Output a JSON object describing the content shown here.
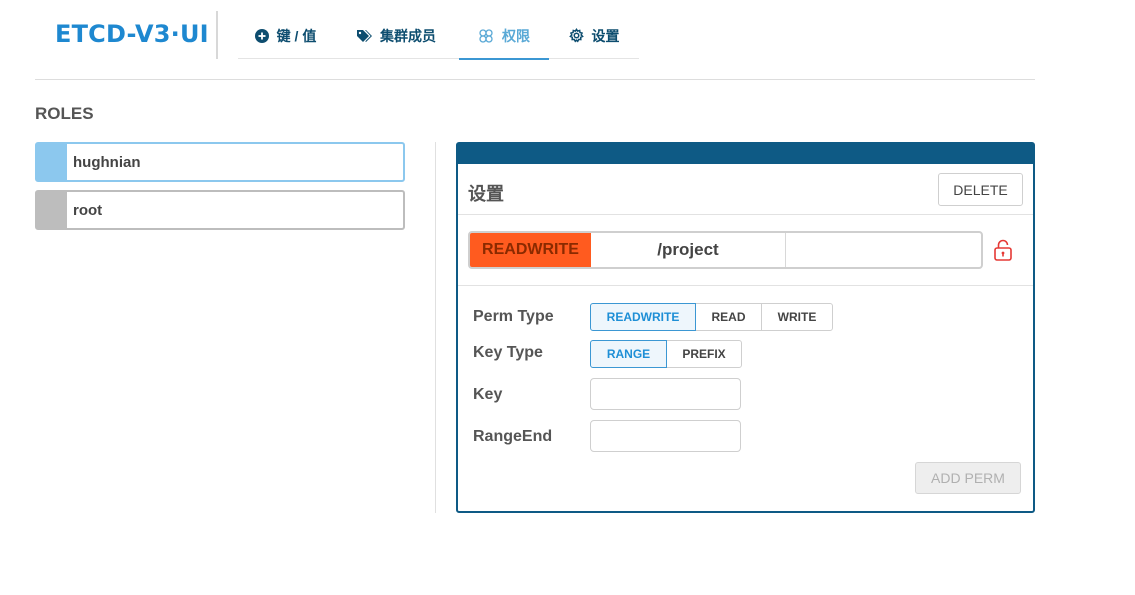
{
  "app": {
    "logo": "ETCD-V3·UI"
  },
  "nav": {
    "tabs": [
      {
        "label": "键 / 值",
        "icon": "plus-circle-icon",
        "active": false
      },
      {
        "label": "集群成员",
        "icon": "tag-icon",
        "active": false
      },
      {
        "label": "权限",
        "icon": "users-icon",
        "active": true
      },
      {
        "label": "设置",
        "icon": "gear-icon",
        "active": false
      }
    ]
  },
  "roles": {
    "title": "ROLES",
    "items": [
      {
        "name": "hughnian",
        "selected": true
      },
      {
        "name": "root",
        "selected": false
      }
    ]
  },
  "panel": {
    "title": "设置",
    "delete_label": "DELETE",
    "permission": {
      "type": "READWRITE",
      "key": "/project",
      "range_end": "",
      "icon": "unlock-icon"
    },
    "form": {
      "perm_type_label": "Perm Type",
      "perm_type_options": [
        "READWRITE",
        "READ",
        "WRITE"
      ],
      "perm_type_selected": "READWRITE",
      "key_type_label": "Key Type",
      "key_type_options": [
        "RANGE",
        "PREFIX"
      ],
      "key_type_selected": "RANGE",
      "key_label": "Key",
      "key_value": "",
      "range_end_label": "RangeEnd",
      "range_end_value": "",
      "add_label": "ADD PERM"
    }
  },
  "colors": {
    "brand": "#1e88d0",
    "panel_header": "#0e5a85",
    "perm_readwrite": "#ff5b1f",
    "selected_role": "#8cc8ee",
    "lock": "#e53935"
  }
}
